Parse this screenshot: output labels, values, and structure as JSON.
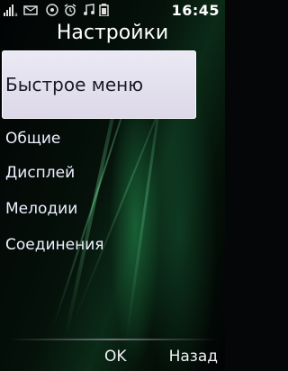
{
  "status": {
    "time": "16:45",
    "icons": [
      "signal-icon",
      "messages-icon",
      "network-icon",
      "alarm-icon",
      "music-icon",
      "battery-icon"
    ]
  },
  "title": "Настройки",
  "menu": {
    "items": [
      {
        "label": "Быстрое меню",
        "selected": true
      },
      {
        "label": "Общие",
        "selected": false
      },
      {
        "label": "Дисплей",
        "selected": false
      },
      {
        "label": "Мелодии",
        "selected": false
      },
      {
        "label": "Соединения",
        "selected": false
      }
    ]
  },
  "softkeys": {
    "left": "",
    "center": "OK",
    "right": "Назад"
  },
  "colors": {
    "background": "#050608",
    "accent_green": "#0b2a17",
    "highlight": "#e6e3ef"
  }
}
